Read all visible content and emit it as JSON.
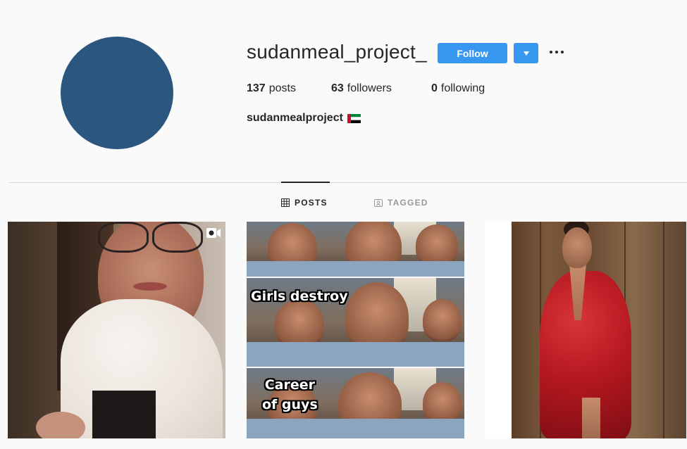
{
  "profile": {
    "username": "sudanmeal_project_",
    "follow_label": "Follow",
    "stats": {
      "posts_count": "137",
      "posts_label": "posts",
      "followers_count": "63",
      "followers_label": "followers",
      "following_count": "0",
      "following_label": "following"
    },
    "bio_name": "sudanmealproject",
    "avatar_color": "#2b5680"
  },
  "tabs": [
    {
      "label": "POSTS",
      "icon": "grid-icon",
      "active": true
    },
    {
      "label": "TAGGED",
      "icon": "tag-icon",
      "active": false
    }
  ],
  "posts": [
    {
      "type": "video",
      "icon": "video-icon"
    },
    {
      "type": "image",
      "caption_top": "Girls destroy",
      "caption_bottom_line1": "Career",
      "caption_bottom_line2": "of guys"
    },
    {
      "type": "image"
    }
  ],
  "colors": {
    "accent": "#3897f0",
    "text": "#262626",
    "muted": "#999999",
    "background": "#fafafa"
  }
}
